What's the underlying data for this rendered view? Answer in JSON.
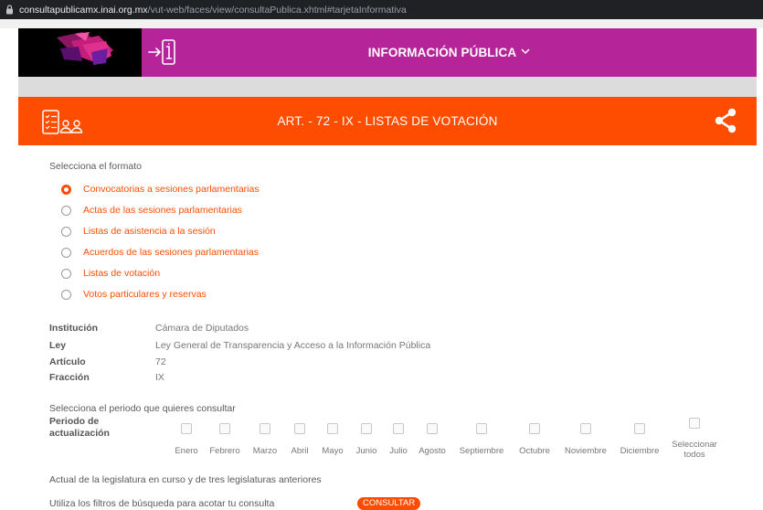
{
  "browser": {
    "url_host": "consultapublicamx.inai.org.mx",
    "url_path": "/vut-web/faces/view/consultaPublica.xhtml#tarjetaInformativa"
  },
  "header": {
    "menu_label": "INFORMACIÓN PÚBLICA"
  },
  "section": {
    "title": "ART. - 72 - IX - LISTAS DE VOTACIÓN"
  },
  "format": {
    "prompt": "Selecciona el formato",
    "selected_index": 0,
    "options": [
      "Convocatorias a sesiones parlamentarias",
      "Actas de las sesiones parlamentarias",
      "Listas de asistencia a la sesión",
      "Acuerdos de las sesiones parlamentarias",
      "Listas de votación",
      "Votos particulares y reservas"
    ]
  },
  "details": {
    "institucion_key": "Institución",
    "institucion_val": "Cámara de Diputados",
    "ley_key": "Ley",
    "ley_val": "Ley General de Transparencia y Acceso a la Información Pública",
    "articulo_key": "Artículo",
    "articulo_val": "72",
    "fraccion_key": "Fracción",
    "fraccion_val": "IX"
  },
  "period": {
    "prompt": "Selecciona el periodo que quieres consultar",
    "key": "Periodo de actualización",
    "months": [
      "Enero",
      "Febrero",
      "Marzo",
      "Abril",
      "Mayo",
      "Junio",
      "Julio",
      "Agosto",
      "Septiembre",
      "Octubre",
      "Noviembre",
      "Diciembre"
    ],
    "select_all": "Seleccionar todos"
  },
  "legislature_note": "Actual de la legislatura en curso y de tres legislaturas anteriores",
  "filters_note": "Utiliza los filtros de búsqueda para acotar tu consulta",
  "consultar_label": "CONSULTAR",
  "colors": {
    "accent_orange": "#fe4d01",
    "header_magenta": "#b52599"
  },
  "icons": {
    "lock": "lock-icon",
    "enter": "enter-info-icon",
    "chevron": "chevron-down-icon",
    "form": "form-users-icon",
    "share": "share-icon"
  }
}
